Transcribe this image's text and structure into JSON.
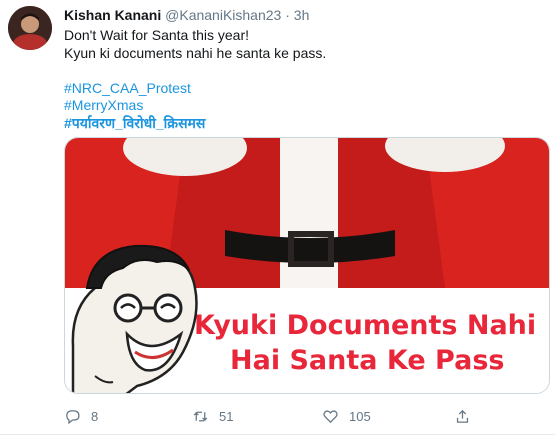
{
  "tweet": {
    "display_name": "Kishan Kanani",
    "handle": "@KananiKishan23",
    "separator": "·",
    "time": "3h",
    "text_lines": [
      "Don't Wait for Santa this year!",
      "Kyun ki documents nahi he santa ke pass."
    ],
    "hashtags": [
      "#NRC_CAA_Protest",
      "#MerryXmas",
      "#पर्यावरण_विरोधी_क्रिसमस"
    ]
  },
  "media": {
    "caption_line1": "Kyuki Documents Nahi",
    "caption_line2": "Hai Santa Ke Pass",
    "colors": {
      "background_red": "#d8231f",
      "caption_red": "#e8283a",
      "panel_white": "#ffffff"
    }
  },
  "actions": {
    "reply_count": "8",
    "retweet_count": "51",
    "like_count": "105",
    "icons": [
      "reply-icon",
      "retweet-icon",
      "like-icon",
      "share-icon"
    ]
  }
}
